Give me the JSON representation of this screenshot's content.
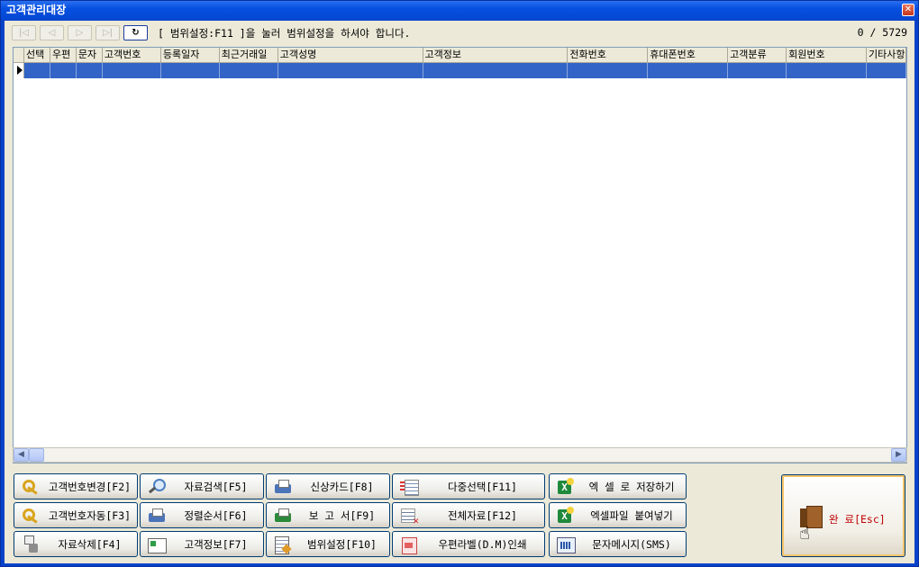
{
  "window": {
    "title": "고객관리대장",
    "close_symbol": "✕"
  },
  "toolbar": {
    "nav_first": "|◁",
    "nav_prev": "◁",
    "nav_next": "▷",
    "nav_last": "▷|",
    "refresh": "↻",
    "hint": "[ 범위설정:F11 ]을 눌러 범위설정을 하셔야 합니다.",
    "record_count": "0 / 5729"
  },
  "grid": {
    "columns": [
      "선택",
      "우편",
      "문자",
      "고객번호",
      "등록일자",
      "최근거래일",
      "고객성명",
      "고객정보",
      "전화번호",
      "휴대폰번호",
      "고객분류",
      "회원번호",
      "기타사항"
    ]
  },
  "scrollbar": {
    "left_arrow": "◀",
    "right_arrow": "▶"
  },
  "buttons": {
    "change_no": "고객번호변경[F2]",
    "auto_no": "고객번호자동[F3]",
    "delete": "자료삭제[F4]",
    "search": "자료검색[F5]",
    "sort": "정렬순서[F6]",
    "info": "고객정보[F7]",
    "card": "신상카드[F8]",
    "report": "보 고 서[F9]",
    "range": "범위설정[F10]",
    "multi_select": "다중선택[F11]",
    "all_data": "전체자료[F12]",
    "dm_print": "우편라벨(D.M)인쇄",
    "excel_save": "엑 셀 로 저장하기",
    "excel_paste": "엑셀파일 붙여넣기",
    "sms": "문자메시지(SMS)",
    "exit": "완 료[Esc]"
  }
}
